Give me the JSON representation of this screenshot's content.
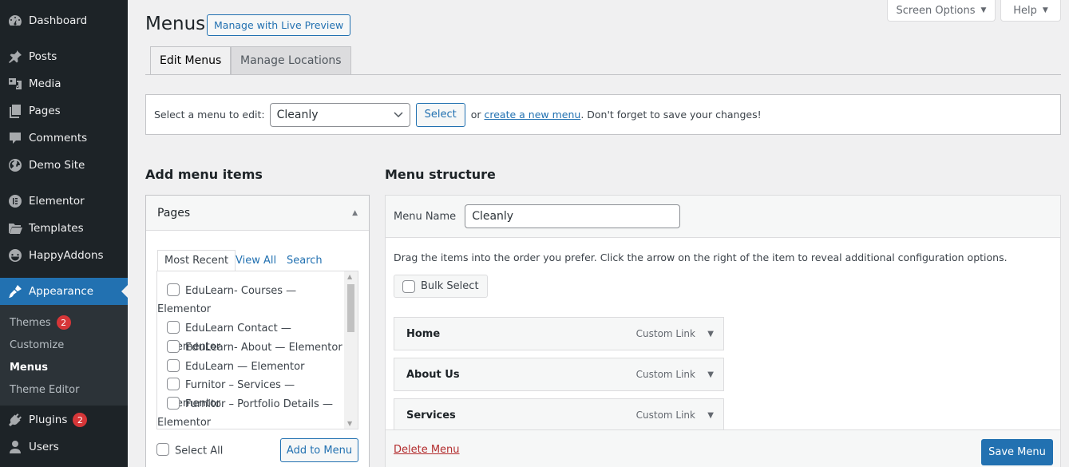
{
  "sidebar": {
    "items": [
      {
        "label": "Dashboard",
        "icon": "dashboard-icon"
      },
      {
        "label": "Posts",
        "icon": "pin-icon"
      },
      {
        "label": "Media",
        "icon": "media-icon"
      },
      {
        "label": "Pages",
        "icon": "pages-icon"
      },
      {
        "label": "Comments",
        "icon": "comment-icon"
      },
      {
        "label": "Demo Site",
        "icon": "globe-icon"
      },
      {
        "label": "Elementor",
        "icon": "elementor-icon"
      },
      {
        "label": "Templates",
        "icon": "folder-icon"
      },
      {
        "label": "HappyAddons",
        "icon": "happy-face-icon"
      },
      {
        "label": "Appearance",
        "icon": "paintbrush-icon"
      },
      {
        "label": "Plugins",
        "icon": "plug-icon",
        "badge": "2"
      },
      {
        "label": "Users",
        "icon": "user-icon"
      }
    ],
    "submenu": [
      {
        "label": "Themes",
        "badge": "2"
      },
      {
        "label": "Customize"
      },
      {
        "label": "Menus"
      },
      {
        "label": "Theme Editor"
      }
    ]
  },
  "screen_meta": {
    "screen_options": "Screen Options",
    "help": "Help"
  },
  "header": {
    "title": "Menus",
    "live_preview": "Manage with Live Preview",
    "tabs": [
      "Edit Menus",
      "Manage Locations"
    ]
  },
  "manage": {
    "label": "Select a menu to edit:",
    "selected": "Cleanly",
    "select_btn": "Select",
    "or": "or",
    "create_link": "create a new menu",
    "suffix": ". Don't forget to save your changes!"
  },
  "add_items": {
    "heading": "Add menu items",
    "box_title": "Pages",
    "tabs": [
      "Most Recent",
      "View All",
      "Search"
    ],
    "pages": [
      {
        "title": "EduLearn- Courses — ",
        "suffix": "Elementor"
      },
      {
        "title": "EduLearn Contact — ",
        "suffix": "Elementor"
      },
      {
        "title": "EduLearn- About — ",
        "suffix": "Elementor"
      },
      {
        "title": "EduLearn — ",
        "suffix": "Elementor"
      },
      {
        "title": "Furnitor – Services — ",
        "suffix": "Elementor"
      },
      {
        "title": "Furnitor – Portfolio Details — ",
        "suffix": "Elementor"
      }
    ],
    "select_all": "Select All",
    "add_btn": "Add to Menu"
  },
  "structure": {
    "heading": "Menu structure",
    "name_label": "Menu Name",
    "name_value": "Cleanly",
    "instructions": "Drag the items into the order you prefer. Click the arrow on the right of the item to reveal additional configuration options.",
    "bulk_select": "Bulk Select",
    "items": [
      {
        "title": "Home",
        "type": "Custom Link"
      },
      {
        "title": "About Us",
        "type": "Custom Link"
      },
      {
        "title": "Services",
        "type": "Custom Link"
      }
    ],
    "delete": "Delete Menu",
    "save": "Save Menu"
  }
}
